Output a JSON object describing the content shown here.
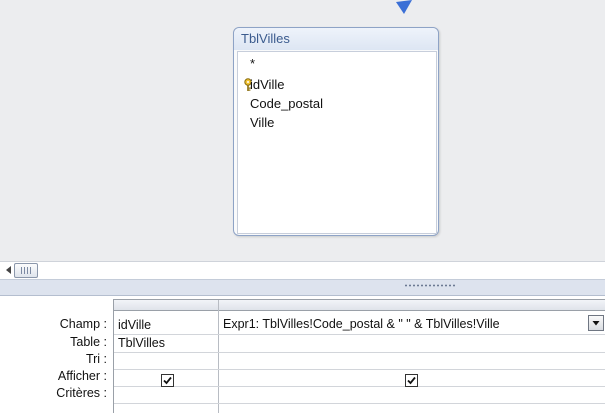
{
  "table_box": {
    "title": "TblVilles",
    "fields": [
      "*",
      "idVille",
      "Code_postal",
      "Ville"
    ],
    "primary_key_field": "idVille",
    "icons": {
      "primary_key": "key-icon"
    }
  },
  "scrollbar": {
    "icons": {
      "left_arrow": "chevron-left-icon",
      "thumb_grip": "grip-icon"
    }
  },
  "grid": {
    "row_labels": {
      "champ": "Champ :",
      "table": "Table :",
      "tri": "Tri :",
      "afficher": "Afficher :",
      "criteres": "Critères :"
    },
    "columns": [
      {
        "field": "idVille",
        "table": "TblVilles",
        "sort": "",
        "show": true
      },
      {
        "field": "Expr1: TblVilles!Code_postal & \" \" & TblVilles!Ville",
        "table": "",
        "sort": "",
        "show": true
      }
    ],
    "icons": {
      "dropdown": "chevron-down-icon",
      "checked": "checkmark-icon"
    }
  },
  "colors": {
    "upper_background": "#ecedef",
    "table_title_text": "#3b5b8e",
    "table_border": "#8ea3c6",
    "arrow": "#3a6fd6",
    "splitter": "#dde3ee"
  }
}
